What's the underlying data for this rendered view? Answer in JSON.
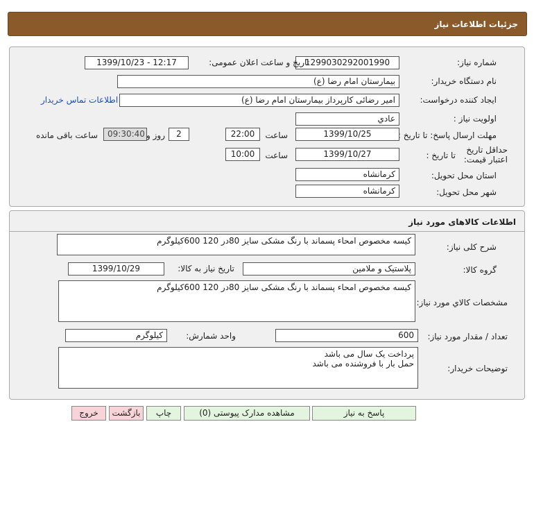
{
  "header": {
    "title": "جزئیات اطلاعات نیاز"
  },
  "details": {
    "need_number_label": "شماره نیاز:",
    "need_number": "1299030292001990",
    "announce_label": "تاریخ و ساعت اعلان عمومی:",
    "announce_value": "1399/10/23 - 12:17",
    "buyer_org_label": "نام دستگاه خریدار:",
    "buyer_org": "بیمارستان امام رضا (ع)",
    "requester_label": "ایجاد کننده درخواست:",
    "requester": "امیر رضائی کارپرداز بیمارستان امام رضا (ع)",
    "contact_link": "اطلاعات تماس خریدار",
    "priority_label": "اولویت نیاز :",
    "priority": "عادي",
    "deadline_label": "مهلت ارسال پاسخ: تا تاریخ :",
    "deadline_date": "1399/10/25",
    "time_label": "ساعت",
    "deadline_time": "22:00",
    "days_value": "2",
    "days_label": "روز و",
    "remaining_time": "09:30:40",
    "remaining_label": "ساعت باقی مانده",
    "validity_label": "حداقل تاریخ اعتبار قیمت:",
    "validity_to_label": "تا تاریخ :",
    "validity_date": "1399/10/27",
    "validity_time_label": "ساعت",
    "validity_time": "10:00",
    "province_label": "استان محل تحویل:",
    "province": "کرمانشاه",
    "city_label": "شهر محل تحویل:",
    "city": "کرمانشاه"
  },
  "goods": {
    "section_title": "اطلاعات کالاهای مورد نیاز",
    "general_desc_label": "شرح کلی نیاز:",
    "general_desc": "کیسه مخصوص امحاء پسماند با رنگ مشکی سایز 80در 120 600کیلوگرم",
    "group_label": "گروه کالا:",
    "group": "پلاستیک و ملامین",
    "need_date_label": "تاریخ نیاز به کالا:",
    "need_date": "1399/10/29",
    "specs_label": "مشخصات کالاي مورد نیاز:",
    "specs": "کیسه مخصوص امحاء پسماند با رنگ مشکی سایز 80در 120 600کیلوگرم",
    "qty_label": "تعداد / مقدار مورد نیاز:",
    "qty": "600",
    "unit_label": "واحد شمارش:",
    "unit": "کیلوگرم",
    "buyer_notes_label": "توضیحات خریدار:",
    "buyer_notes_line1": "پرداخت یک سال می باشد",
    "buyer_notes_line2": "حمل بار با فروشنده می باشد"
  },
  "buttons": {
    "reply": "پاسخ به نیاز",
    "attachments": "مشاهده مدارک پیوستی (0)",
    "print": "چاپ",
    "back": "بازگشت",
    "exit": "خروج"
  }
}
